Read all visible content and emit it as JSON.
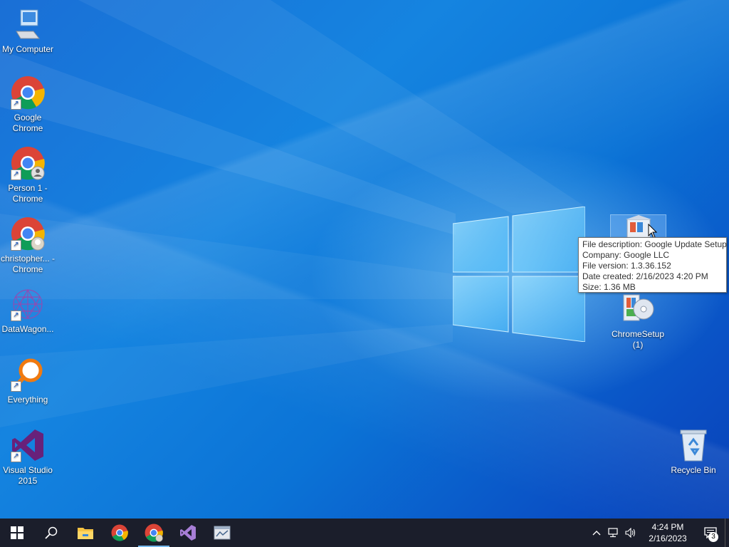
{
  "desktop": {
    "icons": [
      {
        "label": "My Computer"
      },
      {
        "label": "Google Chrome"
      },
      {
        "label": "Person 1 - Chrome"
      },
      {
        "label": "christopher... - Chrome"
      },
      {
        "label": "DataWagon..."
      },
      {
        "label": "Everything"
      },
      {
        "label": "Visual Studio 2015"
      },
      {
        "label": "ChromeSetup (1)"
      },
      {
        "label": "Recycle Bin"
      }
    ],
    "tooltip": {
      "description": "File description: Google Update Setup",
      "company": "Company: Google LLC",
      "version": "File version: 1.3.36.152",
      "created": "Date created: 2/16/2023 4:20 PM",
      "size": "Size: 1.36 MB"
    }
  },
  "taskbar": {
    "clock_time": "4:24 PM",
    "clock_date": "2/16/2023",
    "notification_count": "3",
    "pinned": [
      "start-icon",
      "search-icon",
      "file-explorer-icon",
      "chrome-icon",
      "chrome-profile-icon",
      "visual-studio-icon",
      "app-window-icon"
    ]
  },
  "colors": {
    "taskbar_bg": "#1b1e2b",
    "desktop_blue": "#0a6ad8",
    "active_indicator": "#76b9ed"
  }
}
